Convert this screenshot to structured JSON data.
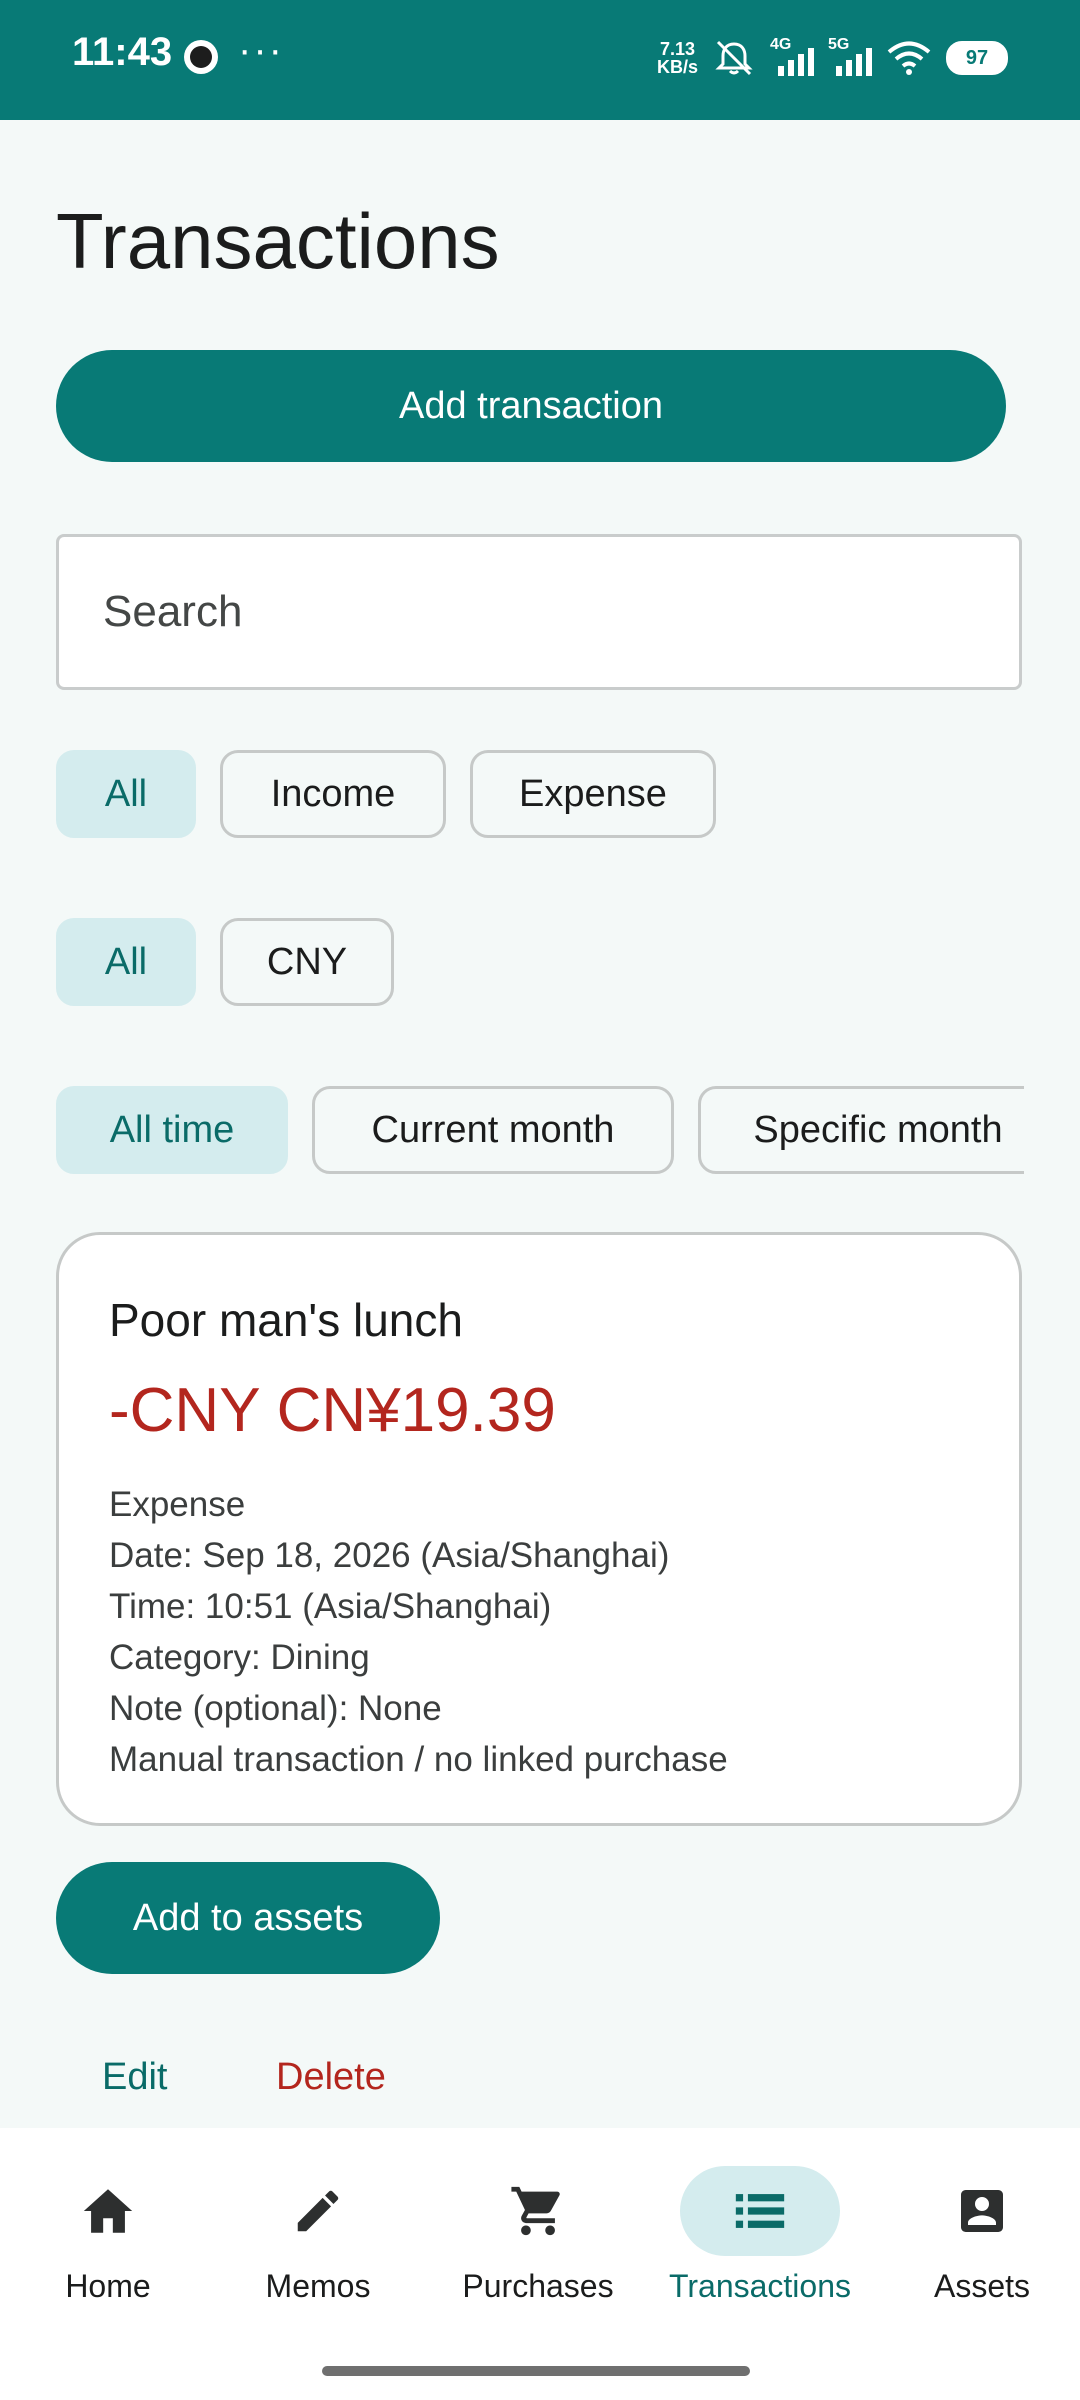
{
  "status_bar": {
    "time": "11:43",
    "more": "···",
    "net_speed_value": "7.13",
    "net_speed_unit": "KB/s",
    "sig1_label": "4G",
    "sig2_label": "5G",
    "battery": "97"
  },
  "page": {
    "title": "Transactions"
  },
  "actions": {
    "add_transaction": "Add transaction"
  },
  "search": {
    "placeholder": "Search"
  },
  "filters": {
    "type": [
      "All",
      "Income",
      "Expense"
    ],
    "currency": [
      "All",
      "CNY"
    ],
    "period": [
      "All time",
      "Current month",
      "Specific month"
    ]
  },
  "transaction": {
    "title": "Poor man's lunch",
    "amount": "-CNY CN¥19.39",
    "type": "Expense",
    "date": "Date: Sep 18, 2026 (Asia/Shanghai)",
    "time": "Time: 10:51 (Asia/Shanghai)",
    "category": "Category: Dining",
    "note": "Note (optional): None",
    "link": "Manual transaction / no linked purchase",
    "add_to_assets": "Add to assets",
    "edit": "Edit",
    "delete": "Delete"
  },
  "nav": {
    "home": "Home",
    "memos": "Memos",
    "purchases": "Purchases",
    "transactions": "Transactions",
    "assets": "Assets"
  },
  "colors": {
    "accent": "#087a76",
    "danger": "#b3261e",
    "selected_chip": "#d4ecee"
  }
}
